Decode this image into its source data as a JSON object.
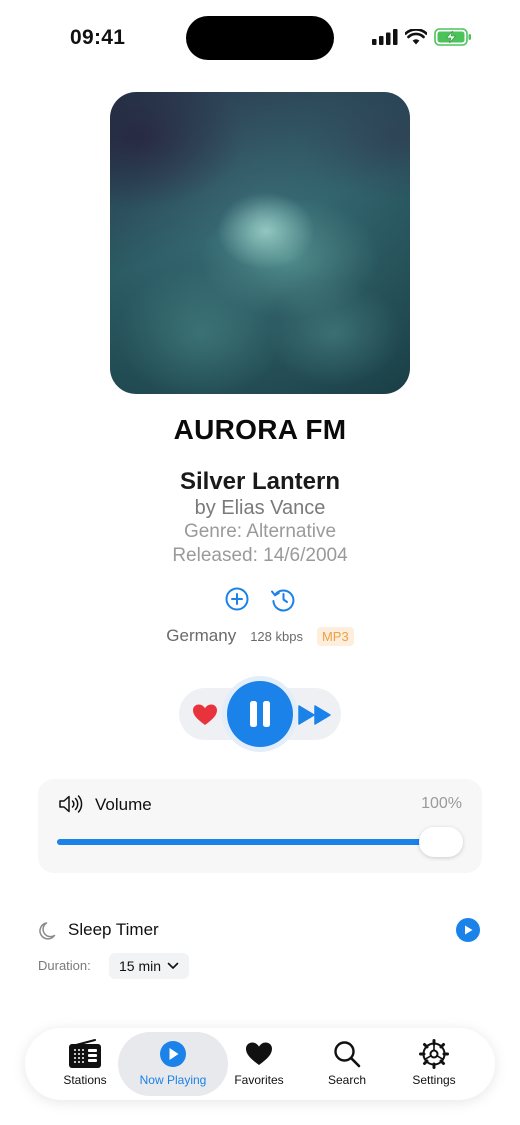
{
  "status_bar": {
    "time": "09:41"
  },
  "station": {
    "name": "AURORA FM"
  },
  "track": {
    "title": "Silver Lantern",
    "artist": "by Elias Vance",
    "genre": "Genre: Alternative",
    "released": "Released: 14/6/2004"
  },
  "stream": {
    "country": "Germany",
    "bitrate": "128 kbps",
    "format": "MP3"
  },
  "colors": {
    "accent": "#1a82e8",
    "favorite": "#e8333d",
    "format_badge": "#f0a040"
  },
  "volume": {
    "label": "Volume",
    "value_text": "100%",
    "level": 0.95
  },
  "sleep_timer": {
    "label": "Sleep Timer",
    "duration_label": "Duration:",
    "duration_value": "15 min"
  },
  "tabs": [
    {
      "label": "Stations",
      "icon": "radio-icon"
    },
    {
      "label": "Now Playing",
      "icon": "play-circle-icon",
      "active": true
    },
    {
      "label": "Favorites",
      "icon": "heart-icon"
    },
    {
      "label": "Search",
      "icon": "search-icon"
    },
    {
      "label": "Settings",
      "icon": "gear-icon"
    }
  ]
}
